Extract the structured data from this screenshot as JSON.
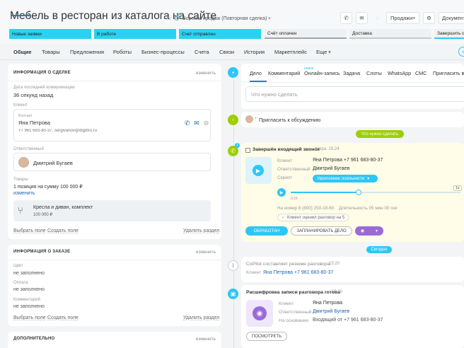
{
  "header": {
    "title": "Мебель в ресторан из каталога на сайте",
    "funnel": "Воронка продаж (Повторная сделка)",
    "sales_button": "Продажи",
    "document_button": "Документ"
  },
  "stages": [
    {
      "label": "Новые заявки",
      "active": true
    },
    {
      "label": "В работе",
      "active": true
    },
    {
      "label": "Счет отправлен",
      "active": true
    },
    {
      "label": "Счёт оплачен",
      "active": false
    },
    {
      "label": "Доставка",
      "active": false
    },
    {
      "label": "Завершить сде",
      "active": false
    }
  ],
  "tabs": [
    "Общие",
    "Товары",
    "Предложения",
    "Роботы",
    "Бизнес-процессы",
    "Счета",
    "Связи",
    "История",
    "Маркетплейс",
    "Еще"
  ],
  "deal_info": {
    "heading": "ИНФОРМАЦИЯ О СДЕЛКЕ",
    "edit": "изменить",
    "last_comm_label": "Дата последней коммуникации",
    "last_comm_value": "36 секунд назад",
    "client_label": "Клиент",
    "contact_label": "Контакт",
    "contact_name": "Яна Петрова",
    "contact_details": "+7 961 683-80-37, sergivanov@digibro.ru",
    "responsible_label": "Ответственный",
    "responsible_name": "Дмитрий Бугаев",
    "products_label": "Товары",
    "products_value": "1 позиция на сумму 100 000 ₽",
    "products_edit": "изменить",
    "product_name": "Кресла и диван, комплект",
    "product_price": "100 000 ₽",
    "select_field": "Выбрать поле",
    "create_field": "Создать поле",
    "delete_section": "Удалить раздел"
  },
  "order_info": {
    "heading": "ИНФОРМАЦИЯ О ЗАКАЗЕ",
    "edit": "изменить",
    "fields": [
      {
        "label": "Цвет",
        "value": "не заполнено"
      },
      {
        "label": "Оплата",
        "value": "не заполнено"
      },
      {
        "label": "Комментарий",
        "value": "не заполнено"
      }
    ],
    "select_field": "Выбрать поле",
    "create_field": "Создать поле",
    "delete_section": "Удалить раздел"
  },
  "extra": {
    "heading": "ДОПОЛНИТЕЛЬНО",
    "edit": "изменить"
  },
  "activity": {
    "tabs": [
      "Дело",
      "Комментарий",
      "Онлайн-запись",
      "Задача",
      "Слоты",
      "WhatsApp",
      "СМС",
      "Пригласить в ч"
    ],
    "new_badge": "новое",
    "placeholder": "Что нужно сделать",
    "invite": "Пригласить к обсуждению"
  },
  "feed": {
    "todo_pill": "Что нужно сделать",
    "call": {
      "title": "Завершён входящий звонок",
      "time": "вчера, 15:24",
      "client_label": "Клиент",
      "client": "Яна Петрова +7 961 683-80-37",
      "resp_label": "Ответственный",
      "resp": "Дмитрий Бугаев",
      "script_label": "Скрипт",
      "script": "Укрепление лояльности",
      "speed": "1x",
      "elapsed": "0:16",
      "number_label": "На номер 8 (800) 250-18-60",
      "duration": "Длительность 05 мин 00 сек",
      "rating": "Клиент оценил разговор на 5",
      "btn_done": "ОБРАБОТАН",
      "btn_plan": "ЗАПЛАНИРОВАТЬ ДЕЛО",
      "progress": 0.4
    },
    "today_pill": "Сегодня",
    "copilot": {
      "title": "CoPilot составляет резюме разговора",
      "time": "15:20",
      "client_label": "Клиент",
      "client": "Яна Петрова +7 961 683-80-37"
    },
    "transcript": {
      "title": "Расшифровка записи разговора готова",
      "time": "15:20",
      "client_label": "Клиент",
      "client": "Яна Петрова",
      "resp_label": "Ответственный",
      "resp": "Дмитрий Бугаев",
      "basis_label": "На основании",
      "basis": "Входящий от +7 961 683-80-37",
      "btn_view": "ПОСМОТРЕТЬ"
    }
  },
  "colors": {
    "accent": "#2fc6f6",
    "green": "#9dcf00",
    "link": "#2067b0",
    "active_stage": "#28d3f1"
  }
}
